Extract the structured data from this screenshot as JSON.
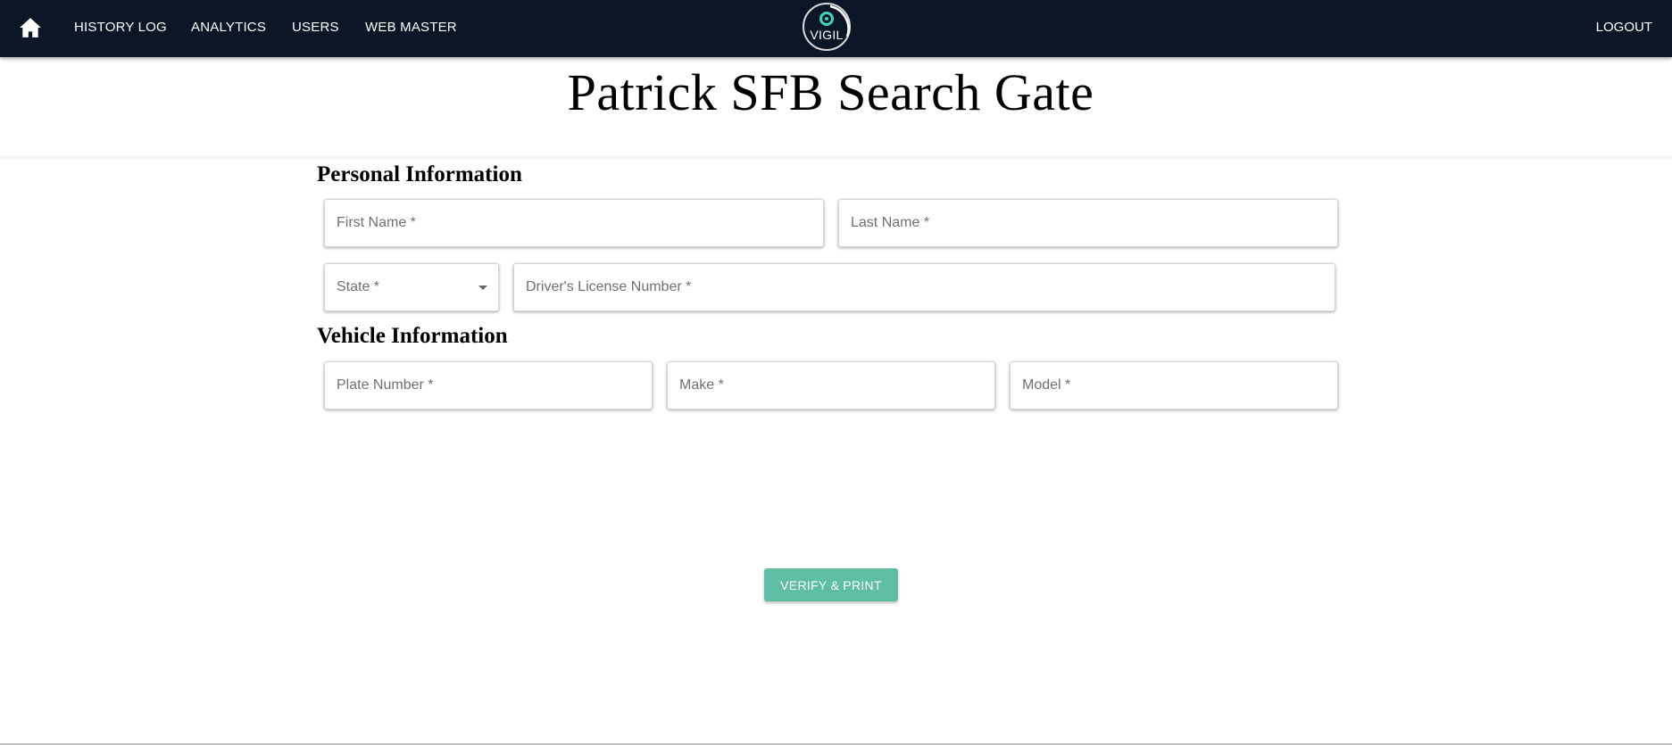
{
  "nav": {
    "home_icon": "home-icon",
    "links": [
      "HISTORY LOG",
      "ANALYTICS",
      "USERS",
      "WEB MASTER"
    ],
    "logo_text": "VIGIL",
    "logout_label": "LOGOUT"
  },
  "page": {
    "title": "Patrick SFB Search Gate"
  },
  "personal": {
    "heading": "Personal Information",
    "first_name_label": "First Name *",
    "last_name_label": "Last Name *",
    "state_label": "State *",
    "license_label": "Driver's License Number *"
  },
  "vehicle": {
    "heading": "Vehicle Information",
    "plate_label": "Plate Number *",
    "make_label": "Make *",
    "model_label": "Model *"
  },
  "actions": {
    "verify_label": "VERIFY & PRINT"
  },
  "colors": {
    "navbar": "#0b1727",
    "accent": "#5dbea3",
    "logo_swirl": "#3fd6b8"
  }
}
